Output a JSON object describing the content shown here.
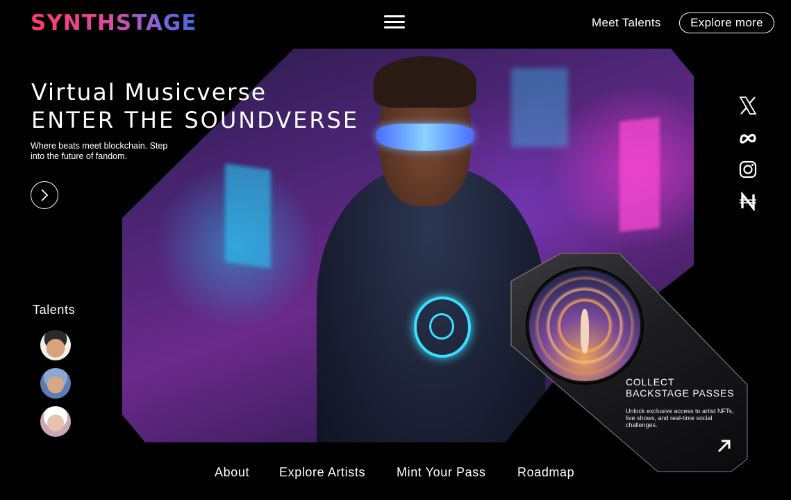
{
  "header": {
    "logo": "SYNTHSTAGE",
    "menu_icon": "hamburger-menu-icon",
    "meet_talents": "Meet Talents",
    "explore_more": "Explore more"
  },
  "hero": {
    "title_line1": "Virtual Musicverse",
    "title_line2": "ENTER THE SOUNDVERSE",
    "subtitle": "Where beats meet blockchain. Step into the future of fandom.",
    "next_icon": "chevron-right-icon"
  },
  "social": [
    {
      "icon": "x-icon"
    },
    {
      "icon": "meta-icon"
    },
    {
      "icon": "instagram-icon"
    },
    {
      "icon": "near-icon"
    }
  ],
  "talents": {
    "title": "Talents",
    "avatars": [
      "avatar-1",
      "avatar-2",
      "avatar-3"
    ]
  },
  "card": {
    "title_line1": "COLLECT",
    "title_line2": "BACKSTAGE PASSES",
    "description": "Unlock exclusive access to artist NFTs, live shows, and real-time social challenges.",
    "arrow_icon": "arrow-up-right-icon"
  },
  "footer_nav": {
    "about": "About",
    "explore_artists": "Explore Artists",
    "mint_pass": "Mint Your Pass",
    "roadmap": "Roadmap"
  },
  "colors": {
    "background": "#000000",
    "logo_gradient_start": "#ff3b6b",
    "logo_gradient_end": "#3d6bd8",
    "neon_cyan": "#39e0ff",
    "neon_magenta": "#ff4ad6"
  }
}
